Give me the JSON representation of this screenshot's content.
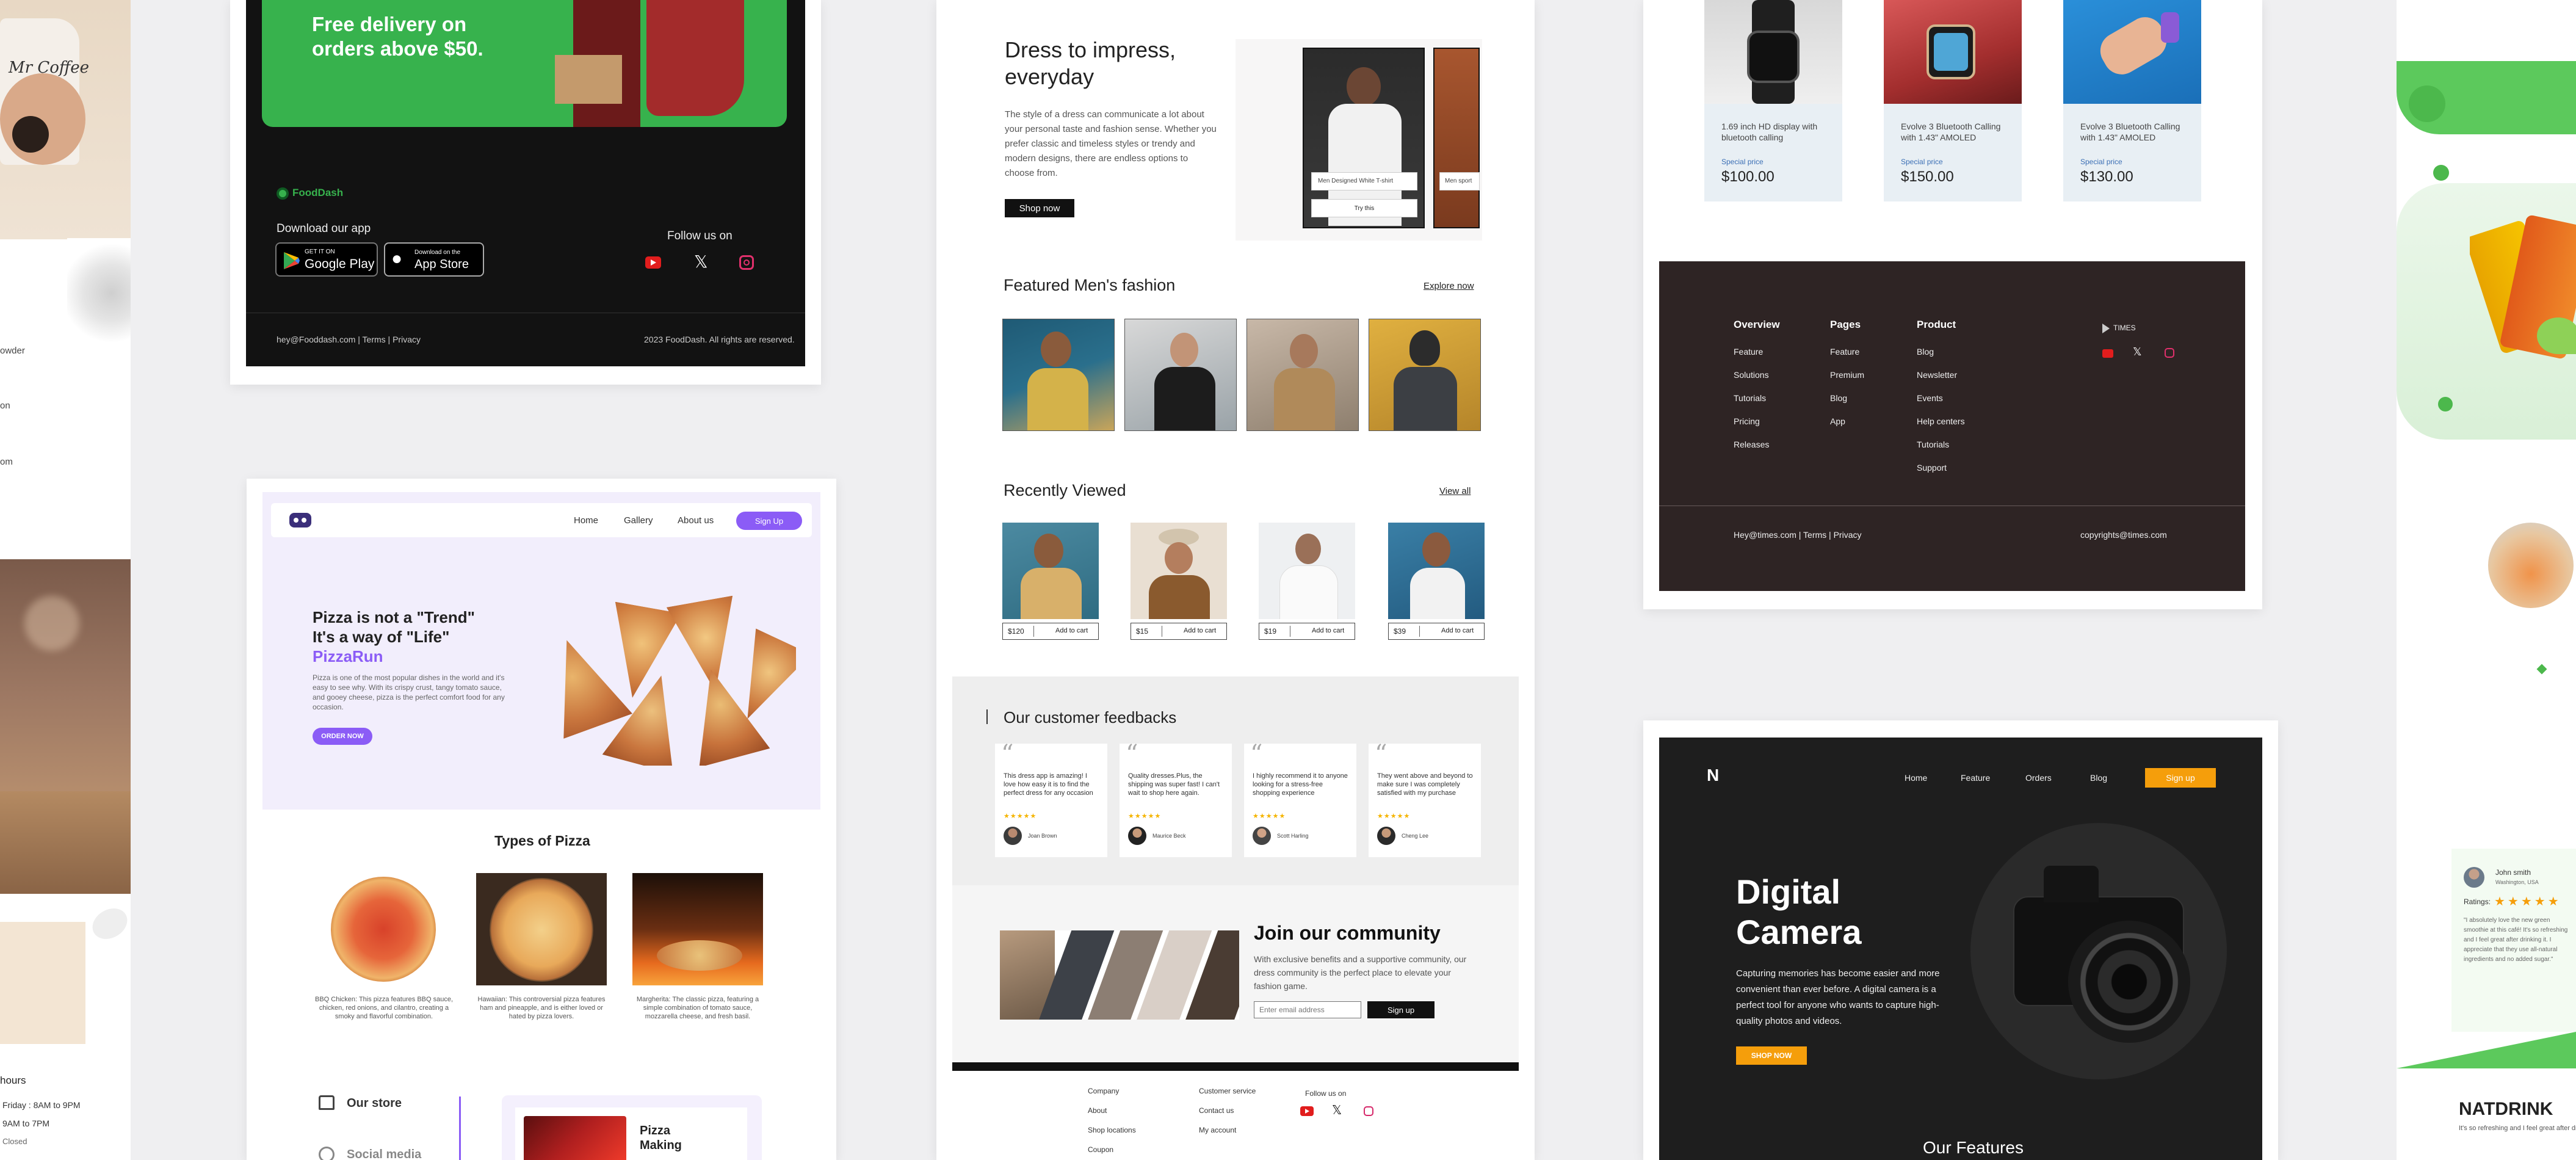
{
  "fooddash": {
    "promo": "Free delivery on orders above $50.",
    "brand": "FoodDash",
    "download_label": "Download our app",
    "google_play_small": "GET IT ON",
    "google_play": "Google Play",
    "app_store_small": "Download on the",
    "app_store": "App Store",
    "follow_label": "Follow us on",
    "contact": "hey@Fooddash.com  |  Terms  |  Privacy",
    "copyright": "2023  FoodDash. All rights are reserved."
  },
  "left_strip": {
    "cup_text": "Mr Coffee",
    "texts": [
      "owder",
      "on",
      "om"
    ],
    "hours_title": "hours",
    "hours": [
      "Friday : 8AM to 9PM",
      "9AM to 7PM",
      "Closed"
    ]
  },
  "pizza": {
    "nav": [
      "Home",
      "Gallery",
      "About us"
    ],
    "signup": "Sign Up",
    "headline1": "Pizza is not a \"Trend\"",
    "headline2": "It's a way of \"Life\"",
    "brand": "PizzaRun",
    "desc": "Pizza is one of the most popular dishes in the world and it's easy to see why. With its crispy crust, tangy tomato sauce, and gooey cheese, pizza is the perfect comfort food for any occasion.",
    "order_btn": "ORDER NOW",
    "types_title": "Types of Pizza",
    "types": [
      {
        "desc": "BBQ Chicken: This pizza features BBQ sauce, chicken, red onions, and cilantro, creating a smoky and flavorful combination."
      },
      {
        "desc": "Hawaiian: This controversial pizza features ham and pineapple, and is either loved or hated by pizza lovers."
      },
      {
        "desc": "Margherita: The classic pizza, featuring a simple combination of tomato sauce, mozzarella cheese, and fresh basil."
      }
    ],
    "our_store": "Our store",
    "social": "Social media",
    "making": "Pizza Making"
  },
  "fashion": {
    "hero_title": "Dress to impress, everyday",
    "hero_desc": "The style of a dress can communicate a lot about your personal taste and fashion sense. Whether you prefer classic and timeless styles or trendy and modern designs, there are endless options to choose from.",
    "shop_btn": "Shop now",
    "product_label": "Men Designed White T-shirt",
    "product_label2": "Men sport",
    "try_btn": "Try this",
    "featured_title": "Featured Men's fashion",
    "explore": "Explore now",
    "recent_title": "Recently Viewed",
    "view_all": "View all",
    "recent": [
      {
        "price": "$120",
        "cta": "Add to cart"
      },
      {
        "price": "$15",
        "cta": "Add to cart"
      },
      {
        "price": "$19",
        "cta": "Add to cart"
      },
      {
        "price": "$39",
        "cta": "Add to cart"
      }
    ],
    "feedback_title": "Our customer feedbacks",
    "feedbacks": [
      {
        "text": "This dress app is amazing! I love how easy it is to find the perfect dress for any occasion",
        "name": "Joan Brown"
      },
      {
        "text": "Quality dresses.Plus, the shipping was super fast! I can't wait to shop here again.",
        "name": "Maurice Beck"
      },
      {
        "text": "I highly recommend it to anyone looking for a stress-free shopping experience",
        "name": "Scott Harling"
      },
      {
        "text": "They went above and beyond to make sure I was completely satisfied with my purchase",
        "name": "Cheng Lee"
      }
    ],
    "stars": "★★★★★",
    "community_title": "Join our community",
    "community_desc": "With exclusive benefits and a supportive community, our dress community is the perfect place to elevate your fashion game.",
    "email_placeholder": "Enter email address",
    "signup": "Sign up",
    "footer_col1": [
      "Company",
      "About",
      "Shop locations",
      "Coupon"
    ],
    "footer_col2": [
      "Customer service",
      "Contact us",
      "My account"
    ],
    "follow": "Follow us on"
  },
  "times": {
    "products": [
      {
        "name": "1.69 inch HD display with bluetooth calling",
        "special": "Special price",
        "price": "$100.00"
      },
      {
        "name": "Evolve 3 Bluetooth Calling with 1.43\" AMOLED",
        "special": "Special price",
        "price": "$150.00"
      },
      {
        "name": "Evolve 3 Bluetooth Calling with 1.43\" AMOLED",
        "special": "Special price",
        "price": "$130.00"
      }
    ],
    "col_overview": {
      "title": "Overview",
      "items": [
        "Feature",
        "Solutions",
        "Tutorials",
        "Pricing",
        "Releases"
      ]
    },
    "col_pages": {
      "title": "Pages",
      "items": [
        "Feature",
        "Premium",
        "Blog",
        "App"
      ]
    },
    "col_product": {
      "title": "Product",
      "items": [
        "Blog",
        "Newsletter",
        "Events",
        "Help centers",
        "Tutorials",
        "Support"
      ]
    },
    "brand": "TIMES",
    "contact": "Hey@times.com  |  Terms  |  Privacy",
    "copyright": "copyrights@times.com"
  },
  "camera": {
    "nav": [
      "Home",
      "Feature",
      "Orders",
      "Blog"
    ],
    "signup": "Sign up",
    "title1": "Digital",
    "title2": "Camera",
    "desc": "Capturing memories has become easier and more convenient than ever before. A digital camera is a perfect tool for anyone who wants to capture high-quality photos and videos.",
    "shop_btn": "SHOP NOW",
    "features": "Our Features"
  },
  "natdrink": {
    "reviewer": "John smith",
    "location": "Washington, USA",
    "ratings_label": "Ratings:",
    "stars": "★★★★★",
    "review": "\"I absolutely love the new green smoothie at this café! It's so refreshing and I feel great after drinking it. I appreciate that they use all-natural ingredients and no added sugar.\"",
    "brand": "NATDRINK",
    "tagline": "It's so refreshing and I feel great after dr"
  },
  "colors": {
    "fooddash_green": "#37b24d",
    "pizza_purple": "#8b5cf6",
    "camera_orange": "#f59e0b",
    "times_dark": "#2e2424"
  }
}
